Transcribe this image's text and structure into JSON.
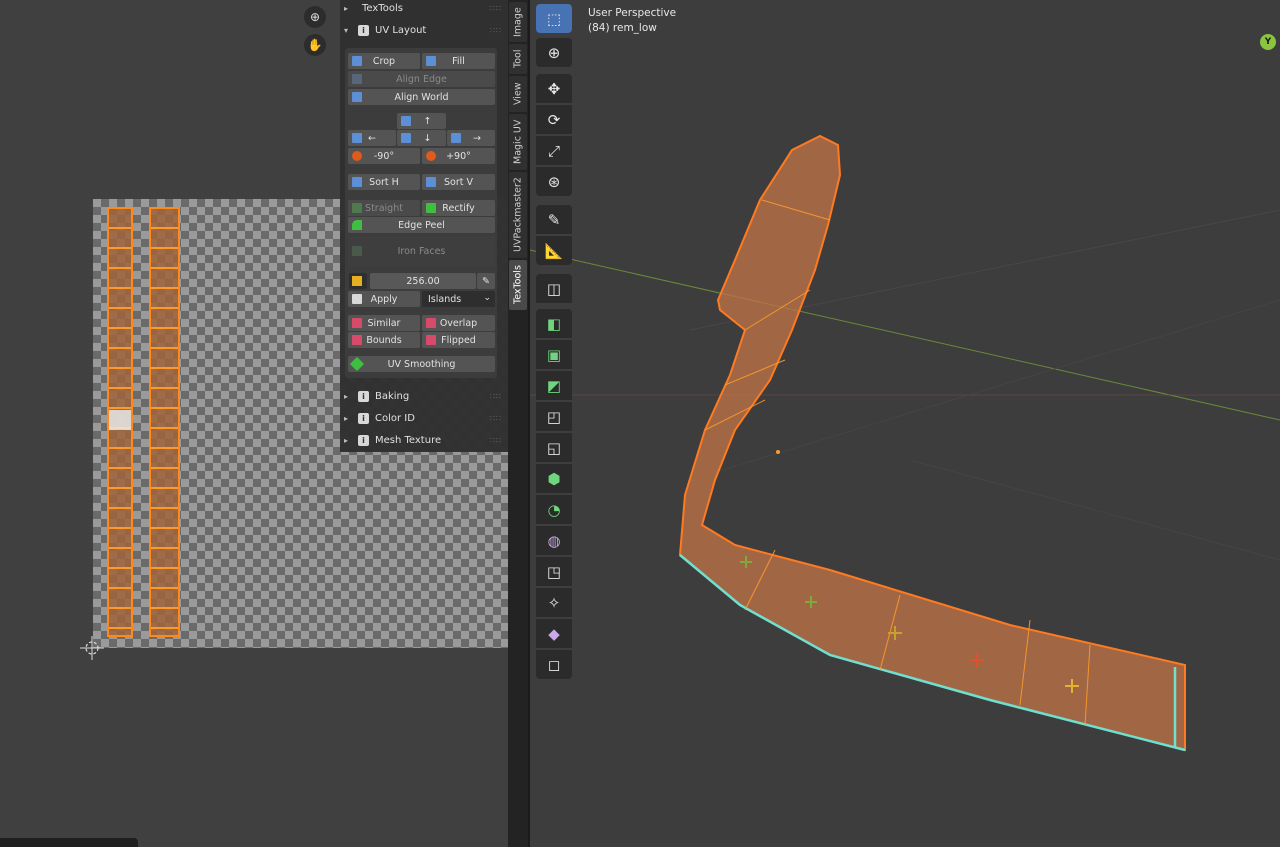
{
  "uv_editor": {
    "panel": {
      "sections": {
        "textools": "TexTools",
        "uv_layout": "UV Layout",
        "baking": "Baking",
        "color_id": "Color ID",
        "mesh_texture": "Mesh Texture"
      },
      "buttons": {
        "crop": "Crop",
        "fill": "Fill",
        "align_edge": "Align Edge",
        "align_world": "Align World",
        "up": "↑",
        "left": "←",
        "down": "↓",
        "right": "→",
        "rot_minus": "-90°",
        "rot_plus": "+90°",
        "sort_h": "Sort H",
        "sort_v": "Sort V",
        "straight": "Straight",
        "rectify": "Rectify",
        "edge_peel": "Edge Peel",
        "iron_faces": "Iron Faces",
        "apply": "Apply",
        "similar": "Similar",
        "overlap": "Overlap",
        "bounds": "Bounds",
        "flipped": "Flipped",
        "uv_smoothing": "UV Smoothing"
      },
      "texel_value": "256.00",
      "apply_mode": "Islands"
    },
    "tabs": [
      "Image",
      "Tool",
      "View",
      "Magic UV",
      "UVPackmaster2",
      "TexTools"
    ],
    "active_tab": "TexTools"
  },
  "viewport": {
    "view_name": "User Perspective",
    "object_label": "(84) rem_low",
    "gizmo_axis": "Y"
  },
  "colors": {
    "accent": "#4772b3",
    "selection": "#ff8a1a",
    "mesh_edge_active": "#6fe0d0",
    "y_axis": "#8bc53f"
  }
}
